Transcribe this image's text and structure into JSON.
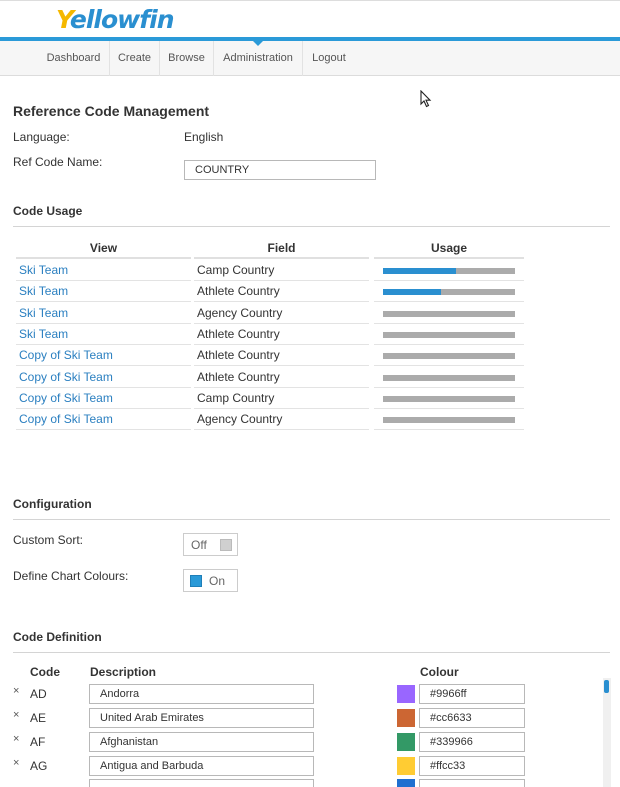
{
  "logo": {
    "part1": "Y",
    "part2": "ellowfin",
    "brand_color": "#2a8fd0",
    "accent_color": "#f5b800"
  },
  "nav": {
    "items": [
      "Dashboard",
      "Create",
      "Browse",
      "Administration",
      "Logout"
    ],
    "active": "Administration"
  },
  "page": {
    "title": "Reference Code Management",
    "language_label": "Language:",
    "language_value": "English",
    "refcode_label": "Ref Code Name:",
    "refcode_value": "COUNTRY"
  },
  "usage": {
    "section_title": "Code Usage",
    "headers": [
      "View",
      "Field",
      "Usage"
    ],
    "rows": [
      {
        "view": "Ski Team",
        "field": "Camp Country",
        "usage": 0.55
      },
      {
        "view": "Ski Team",
        "field": "Athlete Country",
        "usage": 0.44
      },
      {
        "view": "Ski Team",
        "field": "Agency Country",
        "usage": 0
      },
      {
        "view": "Ski Team",
        "field": "Athlete Country",
        "usage": 0
      },
      {
        "view": "Copy of Ski Team",
        "field": "Athlete Country",
        "usage": 0
      },
      {
        "view": "Copy of Ski Team",
        "field": "Athlete Country",
        "usage": 0
      },
      {
        "view": "Copy of Ski Team",
        "field": "Camp Country",
        "usage": 0
      },
      {
        "view": "Copy of Ski Team",
        "field": "Agency Country",
        "usage": 0
      }
    ]
  },
  "configuration": {
    "section_title": "Configuration",
    "custom_sort_label": "Custom Sort:",
    "custom_sort_state": "Off",
    "chart_colours_label": "Define Chart Colours:",
    "chart_colours_state": "On"
  },
  "definition": {
    "section_title": "Code Definition",
    "headers": {
      "code": "Code",
      "description": "Description",
      "colour": "Colour"
    },
    "delete_glyph": "×",
    "rows": [
      {
        "code": "AD",
        "description": "Andorra",
        "colour": "#9966ff"
      },
      {
        "code": "AE",
        "description": "United Arab Emirates",
        "colour": "#cc6633"
      },
      {
        "code": "AF",
        "description": "Afghanistan",
        "colour": "#339966"
      },
      {
        "code": "AG",
        "description": "Antigua and Barbuda",
        "colour": "#ffcc33"
      }
    ],
    "partial_row_colour": "#1f6fd0"
  },
  "icons": {
    "cursor": "mouse-pointer-icon",
    "delete": "close-icon"
  }
}
